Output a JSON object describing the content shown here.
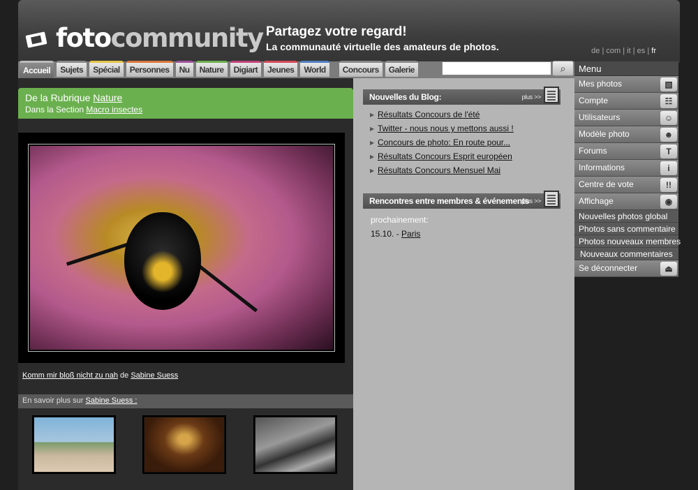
{
  "header": {
    "logo_part1": "foto",
    "logo_part2": "community",
    "tagline1": "Partagez votre regard!",
    "tagline2": "La communauté virtuelle des amateurs de photos.",
    "languages": [
      "de",
      "com",
      "it",
      "es",
      "fr"
    ],
    "active_language": "fr"
  },
  "tabs": [
    {
      "label": "Accueil",
      "accent": "#bbbbbb"
    },
    {
      "label": "Sujets",
      "accent": "#8a8a8a"
    },
    {
      "label": "Spécial",
      "accent": "#e6c34a"
    },
    {
      "label": "Personnes",
      "accent": "#d9783c"
    },
    {
      "label": "Nu",
      "accent": "#a052a0"
    },
    {
      "label": "Nature",
      "accent": "#6bb04f"
    },
    {
      "label": "Digiart",
      "accent": "#c0457a"
    },
    {
      "label": "Jeunes",
      "accent": "#d84a5a"
    },
    {
      "label": "World",
      "accent": "#4f7fc0"
    },
    {
      "label": "Concours",
      "accent": "#888888"
    },
    {
      "label": "Galerie",
      "accent": "#888888"
    }
  ],
  "search": {
    "placeholder": ""
  },
  "rubrique": {
    "prefix": "De la Rubrique",
    "rubrique_link": "Nature",
    "section_prefix": "Dans la Section",
    "section_link": "Macro insectes"
  },
  "photo": {
    "title": "Komm mir bloß nicht zu nah",
    "by": "de",
    "author": "Sabine Suess"
  },
  "more": {
    "prefix": "En savoir plus sur",
    "author_link": "Sabine Suess :"
  },
  "blog": {
    "title": "Nouvelles du Blog:",
    "plus": "plus >>",
    "items": [
      "Résultats Concours de l'été",
      "Twitter - nous nous y mettons aussi !",
      "Concours de photo: En route pour...",
      "Résultats Concours Esprit européen",
      "Résultats Concours Mensuel Mai"
    ]
  },
  "events": {
    "title": "Rencontres entre membres & événements",
    "plus": "plus >>",
    "next_label": "prochainement:",
    "date": "15.10. -",
    "city": "Paris"
  },
  "menu": {
    "title": "Menu",
    "items": [
      {
        "label": "Mes photos",
        "icon": "photos-icon"
      },
      {
        "label": "Compte",
        "icon": "account-icon"
      },
      {
        "label": "Utilisateurs",
        "icon": "users-icon"
      },
      {
        "label": "Modèle photo",
        "icon": "model-icon"
      },
      {
        "label": "Forums",
        "icon": "forums-icon"
      },
      {
        "label": "Informations",
        "icon": "info-icon"
      },
      {
        "label": "Centre de vote",
        "icon": "vote-icon"
      },
      {
        "label": "Affichage",
        "icon": "eye-icon"
      }
    ],
    "subitems": [
      "Nouvelles photos global",
      "Photos sans commentaire",
      "Photos nouveaux membres",
      "Nouveaux commentaires"
    ],
    "logout": {
      "label": "Se déconnecter",
      "icon": "eject-icon"
    }
  }
}
